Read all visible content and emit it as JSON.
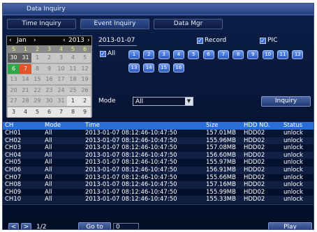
{
  "window": {
    "title": "Data Inquiry"
  },
  "tabs": [
    {
      "label": "Time Inquiry",
      "active": false
    },
    {
      "label": "Event Inquiry",
      "active": true
    },
    {
      "label": "Data Mgr",
      "active": false
    }
  ],
  "calendar": {
    "month": "Jan",
    "year": "2013",
    "prev_arrow": "‹",
    "next_arrow": "›",
    "dow": [
      "S",
      "1",
      "2",
      "3",
      "4",
      "5",
      "6"
    ],
    "weeks": [
      [
        "30",
        "31",
        "1",
        "2",
        "3",
        "4",
        "5"
      ],
      [
        "6",
        "7",
        "8",
        "9",
        "10",
        "11",
        "12"
      ],
      [
        "13",
        "14",
        "15",
        "16",
        "17",
        "18",
        "19"
      ],
      [
        "20",
        "21",
        "22",
        "23",
        "24",
        "25",
        "26"
      ],
      [
        "27",
        "28",
        "29",
        "30",
        "31",
        "1",
        "2"
      ],
      [
        "3",
        "4",
        "5",
        "6",
        "7",
        "8",
        "9"
      ]
    ]
  },
  "filters": {
    "date": "2013-01-07",
    "record_label": "Record",
    "record_checked": true,
    "pic_label": "PIC",
    "pic_checked": true,
    "all_label": "All",
    "all_checked": true,
    "channels": [
      "1",
      "2",
      "3",
      "4",
      "5",
      "6",
      "7",
      "8",
      "9",
      "10",
      "11",
      "12",
      "13",
      "14",
      "15",
      "16"
    ],
    "mode_label": "Mode",
    "mode_value": "All",
    "inquiry_label": "Inquiry"
  },
  "table": {
    "headers": [
      "CH",
      "Mode",
      "Time",
      "Size",
      "HDD NO.",
      "Status"
    ],
    "rows": [
      [
        "CH01",
        "All",
        "2013-01-07 08:12:46-10:47:50",
        "157.01MB",
        "HDD02",
        "unlock"
      ],
      [
        "CH02",
        "All",
        "2013-01-07 08:12:46-10:47:50",
        "155.96MB",
        "HDD02",
        "unlock"
      ],
      [
        "CH03",
        "All",
        "2013-01-07 08:12:46-10:47:50",
        "157.08MB",
        "HDD02",
        "unlock"
      ],
      [
        "CH04",
        "All",
        "2013-01-07 08:12:46-10:47:50",
        "156.60MB",
        "HDD02",
        "unlock"
      ],
      [
        "CH05",
        "All",
        "2013-01-07 08:12:46-10:47:50",
        "155.97MB",
        "HDD02",
        "unlock"
      ],
      [
        "CH06",
        "All",
        "2013-01-07 08:12:46-10:47:50",
        "156.91MB",
        "HDD02",
        "unlock"
      ],
      [
        "CH07",
        "All",
        "2013-01-07 08:12:46-10:47:50",
        "155.66MB",
        "HDD02",
        "unlock"
      ],
      [
        "CH08",
        "All",
        "2013-01-07 08:12:46-10:47:50",
        "157.16MB",
        "HDD02",
        "unlock"
      ],
      [
        "CH09",
        "All",
        "2013-01-07 08:12:46-10:47:50",
        "155.99MB",
        "HDD02",
        "unlock"
      ],
      [
        "CH10",
        "All",
        "2013-01-07 08:12:46-10:47:50",
        "155.33MB",
        "HDD02",
        "unlock"
      ]
    ]
  },
  "footer": {
    "prev": "<",
    "next": ">",
    "page": "1/2",
    "goto_label": "Go to",
    "goto_value": "0",
    "play_label": "Play"
  },
  "colors": {
    "background": "#061535",
    "header_bar": "#2a6fd8",
    "channel_button": "#4a7be0",
    "selected_day_green": "#2fa84a",
    "selected_day_orange": "#e0542a"
  }
}
